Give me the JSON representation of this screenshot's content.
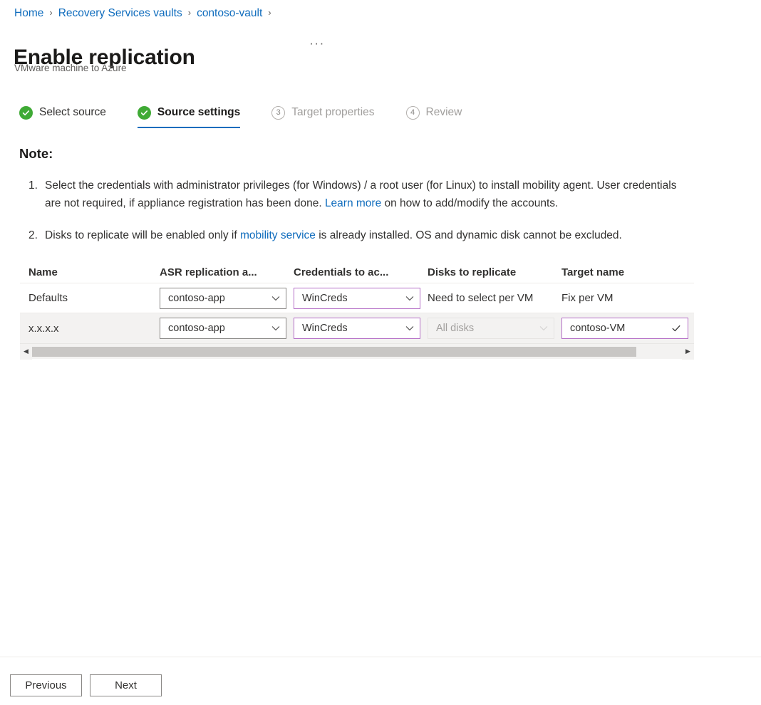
{
  "breadcrumb": {
    "separator": "›",
    "items": [
      {
        "label": "Home"
      },
      {
        "label": "Recovery Services vaults"
      },
      {
        "label": "contoso-vault"
      }
    ]
  },
  "header": {
    "title": "Enable replication",
    "subtitle": "VMware machine to Azure",
    "more_label": "···"
  },
  "steps": [
    {
      "label": "Select source",
      "badge": "✓",
      "state": "done"
    },
    {
      "label": "Source settings",
      "badge": "✓",
      "state": "current"
    },
    {
      "label": "Target properties",
      "badge": "3",
      "state": "disabled"
    },
    {
      "label": "Review",
      "badge": "4",
      "state": "disabled"
    }
  ],
  "note": {
    "heading": "Note:",
    "items": [
      {
        "number": "1.",
        "text_before": "Select the credentials with administrator privileges (for Windows) / a root user (for Linux) to install mobility agent. User credentials are not required, if appliance registration has been done. ",
        "link": "Learn more",
        "text_after": " on how to add/modify the accounts."
      },
      {
        "number": "2.",
        "text_before": "Disks to replicate will be enabled only if ",
        "link": "mobility service",
        "text_after": " is already installed. OS and dynamic disk cannot be excluded."
      }
    ]
  },
  "table": {
    "columns": [
      "Name",
      "ASR replication a...",
      "Credentials to ac...",
      "Disks to replicate",
      "Target name"
    ],
    "rows": [
      {
        "name": "Defaults",
        "asr_appliance": "contoso-app",
        "credentials": "WinCreds",
        "disks": "Need to select per VM",
        "target_name": "Fix per VM"
      },
      {
        "name": "x.x.x.x",
        "asr_appliance": "contoso-app",
        "credentials": "WinCreds",
        "disks": "All disks",
        "target_name": "contoso-VM"
      }
    ],
    "scroll_left_arrow": "◀",
    "scroll_right_arrow": "▶"
  },
  "footer": {
    "previous_label": "Previous",
    "next_label": "Next"
  },
  "colors": {
    "link": "#0f6cbd",
    "accent_field_border": "#b46ec6",
    "step_done": "#3faa35",
    "alt_row_bg": "#f3f2f1"
  }
}
